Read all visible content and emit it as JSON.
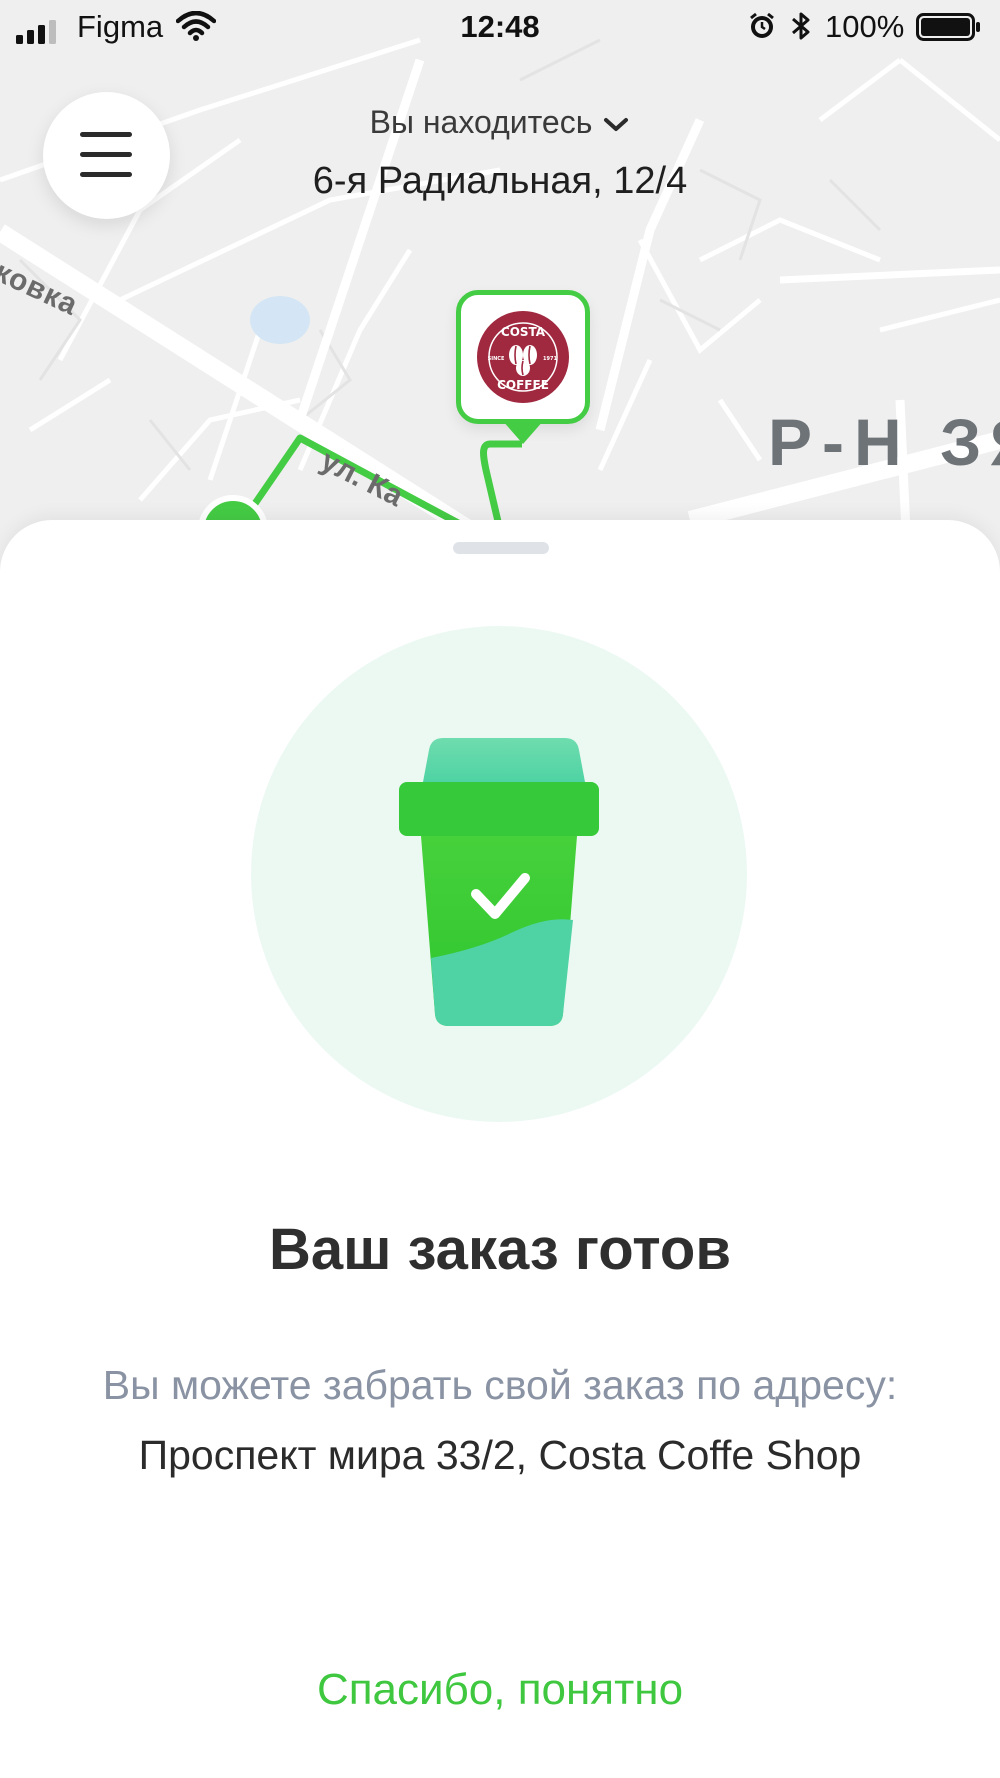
{
  "status_bar": {
    "carrier": "Figma",
    "time": "12:48",
    "battery": "100%"
  },
  "map": {
    "street_label_1": "ковка",
    "street_label_2": "ул. Ка",
    "district_label": "Р-Н ЗЯ"
  },
  "header": {
    "location_caption": "Вы находитесь",
    "location_address": "6-я Радиальная, 12/4"
  },
  "store_pin": {
    "brand_line_1": "COSTA",
    "brand_line_2": "COFFEE",
    "since_left": "SINCE",
    "since_right": "1971",
    "accent_color": "#45cc45",
    "logo_color": "#a0283f"
  },
  "sheet": {
    "title": "Ваш заказ готов",
    "message_prefix": "Вы можете забрать свой заказ по адресу:",
    "message_address": "Проспект мира 33/2, Costa Coffe Shop",
    "confirm_label": "Спасибо, понятно",
    "accent_color": "#3fc83f"
  },
  "icons": {
    "menu": "hamburger-icon",
    "caption_chevron": "chevron-down-icon",
    "order_ready": "coffee-cup-check-icon"
  }
}
